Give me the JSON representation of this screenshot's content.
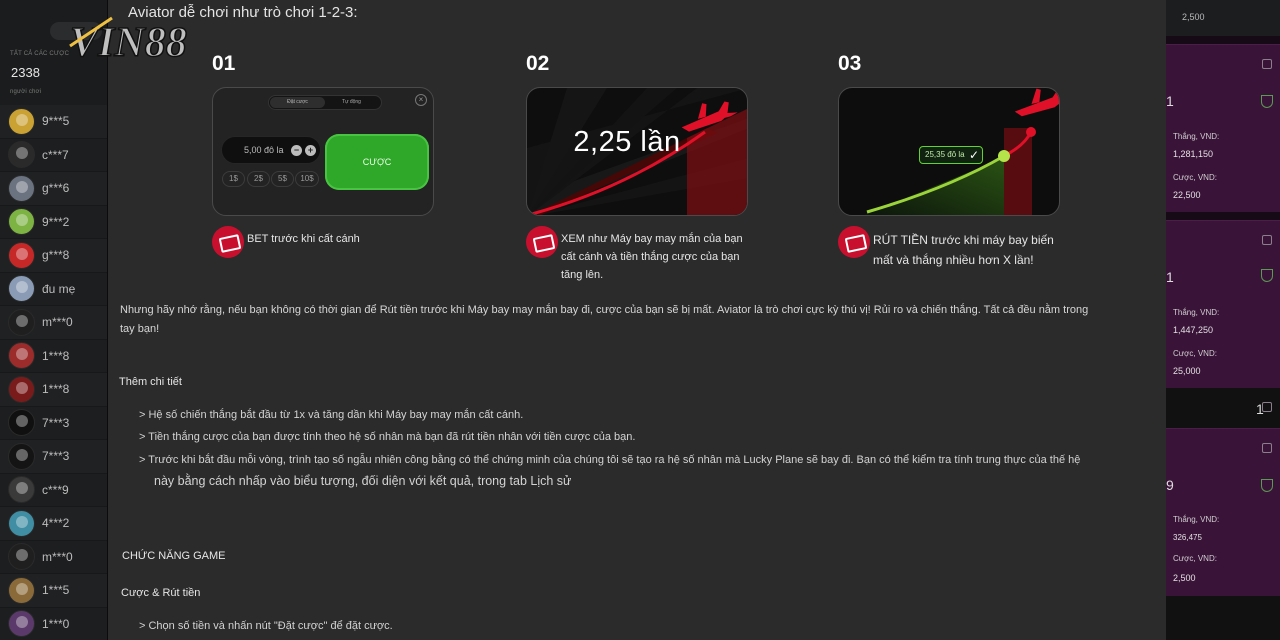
{
  "sidebar": {
    "all_bets_label": "TẤT CẢ CÁC CƯỢC",
    "count": "2338",
    "players_label": "người chơi",
    "bets": [
      {
        "name": "9***5",
        "color": "#c9a233"
      },
      {
        "name": "c***7",
        "color": "#2a2a2a"
      },
      {
        "name": "g***6",
        "color": "#6b7280"
      },
      {
        "name": "9***2",
        "color": "#7cb342"
      },
      {
        "name": "g***8",
        "color": "#c62828"
      },
      {
        "name": "đu mẹ",
        "color": "#8a9bb5"
      },
      {
        "name": "m***0",
        "color": "#1f1f1f"
      },
      {
        "name": "1***8",
        "color": "#9c2b2b"
      },
      {
        "name": "1***8",
        "color": "#7a1b1b"
      },
      {
        "name": "7***3",
        "color": "#101010"
      },
      {
        "name": "7***3",
        "color": "#141414"
      },
      {
        "name": "c***9",
        "color": "#3a3a3a"
      },
      {
        "name": "4***2",
        "color": "#3f8ea3"
      },
      {
        "name": "m***0",
        "color": "#1f1f1f"
      },
      {
        "name": "1***5",
        "color": "#8b6a3a"
      },
      {
        "name": "1***0",
        "color": "#5b3a6b"
      }
    ]
  },
  "logo": {
    "text": "VIN88",
    "color": "#f2f2f2"
  },
  "main": {
    "intro": "Aviator dễ chơi như trò chơi 1-2-3:",
    "steps": [
      {
        "number": "01",
        "caption": "BET trước khi cất cánh"
      },
      {
        "number": "02",
        "caption_line1": "XEM như Máy bay may mắn của bạn",
        "caption_line2": "cất cánh và tiền thắng cược của bạn",
        "caption_line3": "tăng lên."
      },
      {
        "number": "03",
        "caption_line1": "RÚT TIỀN trước khi máy bay biến",
        "caption_line2": "mất và thắng nhiều hơn X lần!"
      }
    ],
    "card1": {
      "tab_bet": "Đặt cược",
      "tab_auto": "Tự động",
      "amount": "5,00 đô la",
      "minus": "−",
      "plus": "+",
      "chips": [
        "1$",
        "2$",
        "5$",
        "10$"
      ],
      "bet_button": "CƯỢC"
    },
    "card2": {
      "multiplier": "2,25 lần"
    },
    "card3": {
      "cashout_amount": "25,35 đô la",
      "check": "✓"
    },
    "paragraph_line1": "Nhưng hãy nhớ rằng, nếu bạn không có thời gian để Rút tiền trước khi Máy bay may mắn bay đi, cược của bạn sẽ bị mất. Aviator là trò chơi cực kỳ thú vị! Rủi ro và chiến thắng. Tất cả đều nằm trong",
    "paragraph_line2": "tay bạn!",
    "details_heading": "Thêm chi tiết",
    "details": [
      "> Hệ số chiến thắng bắt đầu từ 1x và tăng dần khi Máy bay may mắn cất cánh.",
      "> Tiền thắng cược của bạn được tính theo hệ số nhân mà bạn đã rút tiền nhân với tiền cược của bạn.",
      "> Trước khi bắt đầu mỗi vòng, trình tạo số ngẫu nhiên công bằng có thể chứng minh của chúng tôi sẽ tạo ra hệ số nhân mà Lucky Plane sẽ bay đi. Bạn có thể kiểm tra tính trung thực của thế hệ",
      "này bằng cách nhấp vào biểu tượng, đối diện với kết quả, trong tab Lịch sử"
    ],
    "functions_heading": "CHỨC NĂNG GAME",
    "bet_cashout_heading": "Cược & Rút tiền",
    "bet_cashout_item": "> Chọn số tiền và nhấn nút \"Đặt cược\" để đặt cược."
  },
  "right_panel": {
    "top_value": "2,500",
    "win_label": "Thắng, VND:",
    "bet_label": "Cược, VND:",
    "cards": [
      {
        "win": "1,281,150",
        "bet": "22,500"
      },
      {
        "win": "1,447,250",
        "bet": "25,000"
      },
      {
        "win": "326,475",
        "bet": "2,500"
      }
    ],
    "digits": [
      "1",
      "1",
      "1",
      "9"
    ]
  },
  "colors": {
    "accent_red": "#c8102e",
    "bet_green": "#2fa82a",
    "curve_green": "#9bd33a",
    "panel_purple": "#3a1339"
  }
}
